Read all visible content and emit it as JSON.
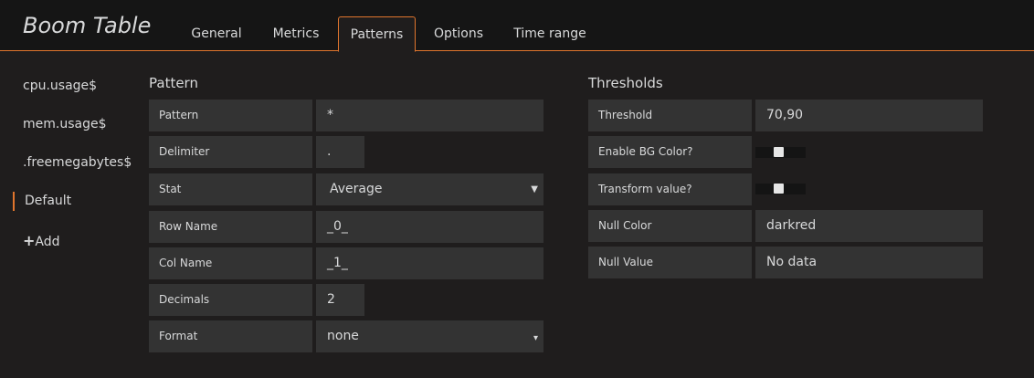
{
  "header": {
    "title": "Boom Table",
    "tabs": [
      {
        "label": "General"
      },
      {
        "label": "Metrics"
      },
      {
        "label": "Patterns"
      },
      {
        "label": "Options"
      },
      {
        "label": "Time range"
      }
    ],
    "active_tab": "Patterns",
    "accent_color": "#e0752d"
  },
  "sidebar": {
    "items": [
      {
        "label": "cpu.usage$"
      },
      {
        "label": "mem.usage$"
      },
      {
        "label": ".freemegabytes$"
      },
      {
        "label": "Default"
      }
    ],
    "active_item": "Default",
    "add_label": "Add",
    "add_icon": "plus-icon"
  },
  "pattern": {
    "title": "Pattern",
    "rows": [
      {
        "label": "Pattern",
        "value": "*"
      },
      {
        "label": "Delimiter",
        "value": "."
      },
      {
        "label": "Stat",
        "value": "Average"
      },
      {
        "label": "Row Name",
        "value": "_0_"
      },
      {
        "label": "Col Name",
        "value": "_1_"
      },
      {
        "label": "Decimals",
        "value": "2"
      },
      {
        "label": "Format",
        "value": "none"
      }
    ]
  },
  "thresholds": {
    "title": "Thresholds",
    "rows": [
      {
        "label": "Threshold",
        "value": "70,90"
      },
      {
        "label": "Enable BG Color?"
      },
      {
        "label": "Transform value?"
      },
      {
        "label": "Null Color",
        "value": "darkred"
      },
      {
        "label": "Null Value",
        "value": "No data"
      }
    ]
  }
}
